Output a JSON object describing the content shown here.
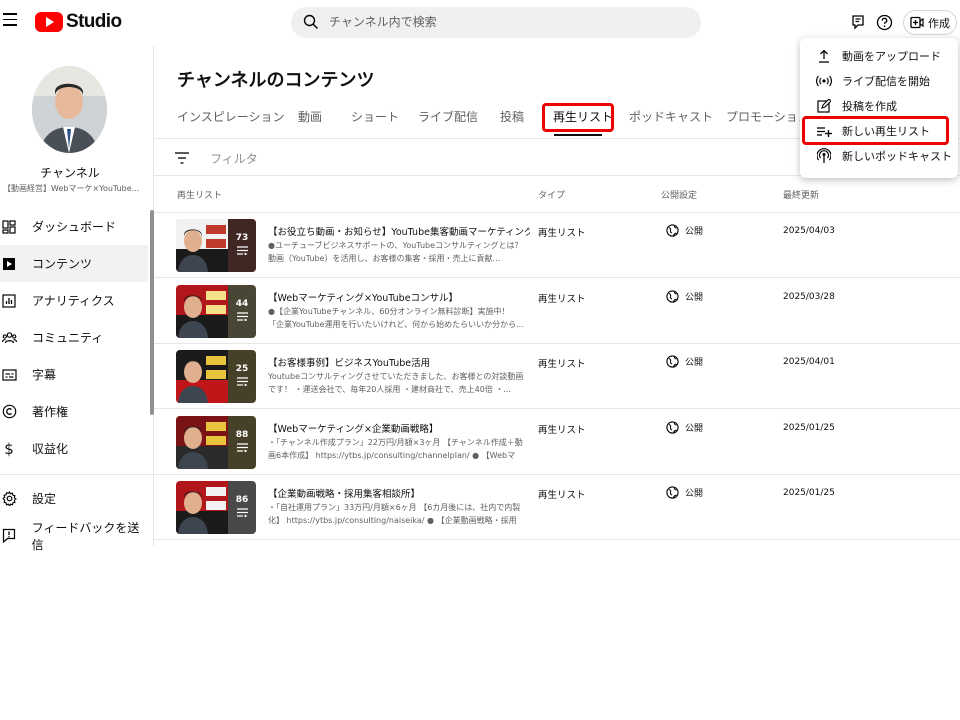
{
  "header": {
    "logo_text": "Studio",
    "search_placeholder": "チャンネル内で検索",
    "create_label": "作成"
  },
  "sidebar": {
    "channel_name": "チャンネル",
    "channel_subtitle": "【動画経営】Webマーケ×YouTube...",
    "items": [
      {
        "label": "ダッシュボード",
        "icon": "dashboard-icon"
      },
      {
        "label": "コンテンツ",
        "icon": "content-icon",
        "active": true
      },
      {
        "label": "アナリティクス",
        "icon": "analytics-icon"
      },
      {
        "label": "コミュニティ",
        "icon": "community-icon"
      },
      {
        "label": "字幕",
        "icon": "subtitles-icon"
      },
      {
        "label": "著作権",
        "icon": "copyright-icon"
      },
      {
        "label": "収益化",
        "icon": "dollar-icon"
      }
    ],
    "bottom_items": [
      {
        "label": "設定",
        "icon": "gear-icon"
      },
      {
        "label": "フィードバックを送信",
        "icon": "feedback-icon"
      }
    ]
  },
  "main": {
    "title": "チャンネルのコンテンツ",
    "tabs": [
      {
        "label": "インスピレーション"
      },
      {
        "label": "動画"
      },
      {
        "label": "ショート"
      },
      {
        "label": "ライブ配信"
      },
      {
        "label": "投稿"
      },
      {
        "label": "再生リスト",
        "active": true
      },
      {
        "label": "ポッドキャスト"
      },
      {
        "label": "プロモーション"
      }
    ],
    "filter_label": "フィルタ",
    "columns": {
      "playlist": "再生リスト",
      "type": "タイプ",
      "visibility": "公開設定",
      "updated": "最終更新"
    },
    "rows": [
      {
        "count": "73",
        "title": "【お役立ち動画・お知らせ】YouTube集客動画マーケティング",
        "desc": "●ユーチューブビジネスサポートの、YouTubeコンサルティングとは？ 動画（YouTube）を活用し、お客様の集客・採用・売上に貢献...",
        "type": "再生リスト",
        "visibility": "公開",
        "date": "2025/04/03"
      },
      {
        "count": "44",
        "title": "【Webマーケティング×YouTubeコンサル】",
        "desc": "●【企業YouTubeチャンネル、60分オンライン無料診断】実施中！ 「企業YouTube運用を行いたいけれど、何から始めたらいいか分から...",
        "type": "再生リスト",
        "visibility": "公開",
        "date": "2025/03/28"
      },
      {
        "count": "25",
        "title": "【お客様事例】ビジネスYouTube活用",
        "desc": "Youtubeコンサルティングさせていただきました、お客様との対談動画です！ ・運送会社で、毎年20人採用 ・建材商社で、売上40倍 ・...",
        "type": "再生リスト",
        "visibility": "公開",
        "date": "2025/04/01"
      },
      {
        "count": "88",
        "title": "【Webマーケティング×企業動画戦略】",
        "desc": "・「チャンネル作成プラン」22万円/月額×3ヶ月 【チャンネル作成＋動画6本作成】 https://ytbs.jp/consulting/channelplan/ ● 【Webマー...",
        "type": "再生リスト",
        "visibility": "公開",
        "date": "2025/01/25"
      },
      {
        "count": "86",
        "title": "【企業動画戦略・採用集客相談所】",
        "desc": "・「自社運用プラン」33万円/月額×6ヶ月 【6カ月後には、社内で内製化】 https://ytbs.jp/consulting/naiseika/ ● 【企業動画戦略・採用集...",
        "type": "再生リスト",
        "visibility": "公開",
        "date": "2025/01/25"
      }
    ]
  },
  "create_menu": {
    "items": [
      {
        "label": "動画をアップロード",
        "icon": "upload-icon"
      },
      {
        "label": "ライブ配信を開始",
        "icon": "live-icon"
      },
      {
        "label": "投稿を作成",
        "icon": "edit-icon"
      },
      {
        "label": "新しい再生リスト",
        "icon": "playlist-add-icon"
      },
      {
        "label": "新しいポッドキャスト",
        "icon": "podcast-icon"
      }
    ]
  },
  "colors": {
    "brand_red": "#ff0000",
    "highlight_red": "#ee0000"
  }
}
